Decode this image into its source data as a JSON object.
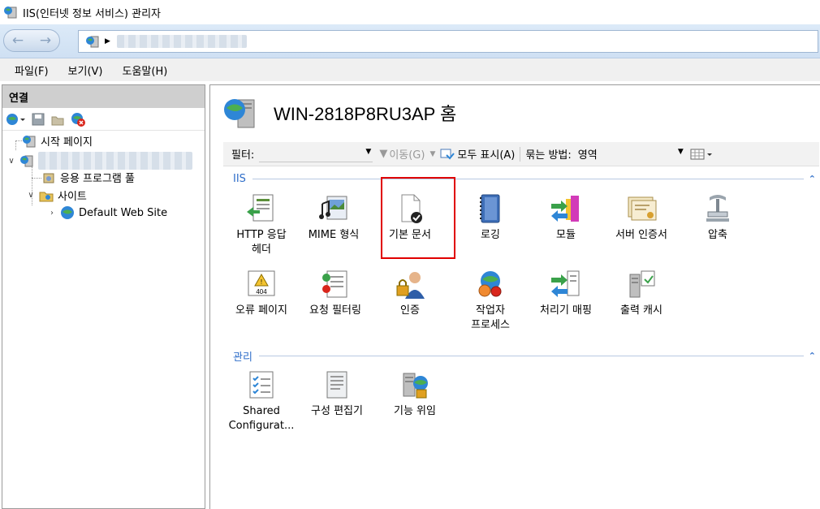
{
  "window": {
    "title": "IIS(인터넷 정보 서비스) 관리자"
  },
  "menu": [
    "파일(F)",
    "보기(V)",
    "도움말(H)"
  ],
  "connections": {
    "header": "연결",
    "tree": {
      "start_page": "시작 페이지",
      "app_pools": "응용 프로그램 풀",
      "sites": "사이트",
      "default_site": "Default Web Site"
    }
  },
  "main": {
    "title": "WIN-2818P8RU3AP 홈",
    "filter_label": "필터:",
    "go_label": "이동(G)",
    "show_all_label": "모두 표시(A)",
    "group_by_label": "묶는 방법:",
    "group_by_value": "영역",
    "sections": [
      {
        "name": "IIS",
        "features": [
          "HTTP 응답\n헤더",
          "MIME 형식",
          "기본 문서",
          "로깅",
          "모듈",
          "서버 인증서",
          "압축",
          "오류 페이지",
          "요청 필터링",
          "인증",
          "작업자\n프로세스",
          "처리기 매핑",
          "출력 캐시"
        ]
      },
      {
        "name": "관리",
        "features": [
          "Shared\nConfigurat...",
          "구성 편집기",
          "기능 위임"
        ]
      }
    ],
    "highlighted_feature": "기본 문서"
  },
  "icons": {
    "http_headers": "http-response-headers-icon",
    "mime": "mime-types-icon",
    "default_doc": "default-document-icon",
    "logging": "logging-icon",
    "modules": "modules-icon",
    "server_cert": "server-certificates-icon",
    "compression": "compression-icon",
    "error_pages": "error-pages-icon",
    "request_filtering": "request-filtering-icon",
    "auth": "authentication-icon",
    "worker_processes": "worker-processes-icon",
    "handler_mappings": "handler-mappings-icon",
    "output_cache": "output-caching-icon",
    "shared_config": "shared-configuration-icon",
    "config_editor": "configuration-editor-icon",
    "delegation": "feature-delegation-icon"
  },
  "colors": {
    "highlight": "#e00000",
    "section_text": "#2f6ec9"
  }
}
